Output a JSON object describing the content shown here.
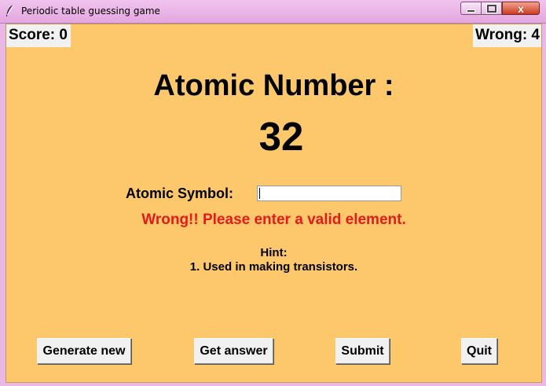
{
  "window": {
    "title": "Periodic table guessing game",
    "controls": {
      "minimize": "",
      "maximize": "",
      "close": "x"
    }
  },
  "score": {
    "text": "Score: 0"
  },
  "wrong": {
    "text": "Wrong: 4"
  },
  "question": {
    "label": "Atomic Number :",
    "value": "32"
  },
  "answer": {
    "label": "Atomic Symbol:",
    "value": ""
  },
  "message": "Wrong!! Please enter a valid element.",
  "hint": {
    "title": "Hint:",
    "text": "1. Used in making transistors."
  },
  "buttons": {
    "generate": "Generate new",
    "get_answer": "Get answer",
    "submit": "Submit",
    "quit": "Quit"
  },
  "colors": {
    "background": "#fdc76c",
    "message": "#e51a1a"
  }
}
